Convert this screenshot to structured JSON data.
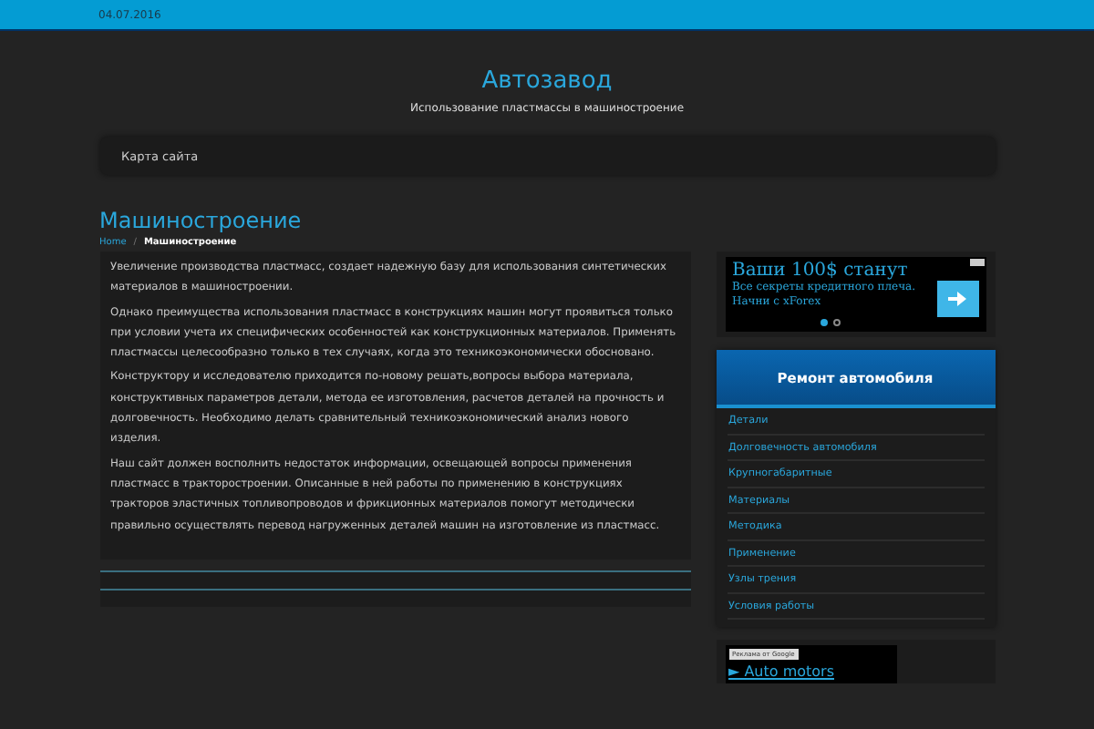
{
  "top_bar": {
    "date": "04.07.2016"
  },
  "header": {
    "title": "Автозавод",
    "tagline": "Использование пластмассы в машиностроение"
  },
  "nav": {
    "items": [
      {
        "label": "Карта сайта"
      }
    ]
  },
  "page": {
    "title": "Машиностроение",
    "breadcrumb_separator": "/",
    "breadcrumb": [
      {
        "label": "Home",
        "current": false
      },
      {
        "label": "Машиностроение",
        "current": true
      }
    ],
    "paragraphs": [
      "Увеличение производства пластмасс, создает надежную базу для использования синтетических материалов в машиностроении.",
      "Однако преимущества использования пластмасс в конструкциях машин могут проявиться только при условии учета их специфических особенностей как конструкционных материалов. Применять пластмассы целесообразно только в тех случаях, когда это техникоэкономически обосновано.",
      "Конструктору и исследователю приходится по-новому решать,вопросы выбора материала, конструктивных параметров детали, метода ее изготовления, расчетов деталей на прочность и долговечность. Необходимо делать сравнительный техникоэкономический анализ нового изделия.",
      "Наш сайт должен восполнить недостаток информации, освещающей вопросы применения пластмасс в тракторостроении. Описанные в ней работы по применению в конструкциях тракторов эластичных топливопроводов и фрикционных материалов помогут методически правильно осуществлять перевод нагруженных деталей машин на изготовление из пластмасс."
    ]
  },
  "sidebar": {
    "ad": {
      "headline": "Ваши 100$ станут",
      "text": "Все секреты кредитного плеча. Начни с xForex",
      "dots": [
        {
          "selected": true
        },
        {
          "selected": false
        }
      ]
    },
    "widget": {
      "title": "Ремонт автомобиля",
      "items": [
        "Детали",
        "Долговечность автомобиля",
        "Крупногабаритные",
        "Материалы",
        "Методика",
        "Применение",
        "Узлы трения",
        "Условия работы"
      ]
    },
    "ad2": {
      "label": "Реклама от Google",
      "link": "► Auto motors"
    }
  }
}
